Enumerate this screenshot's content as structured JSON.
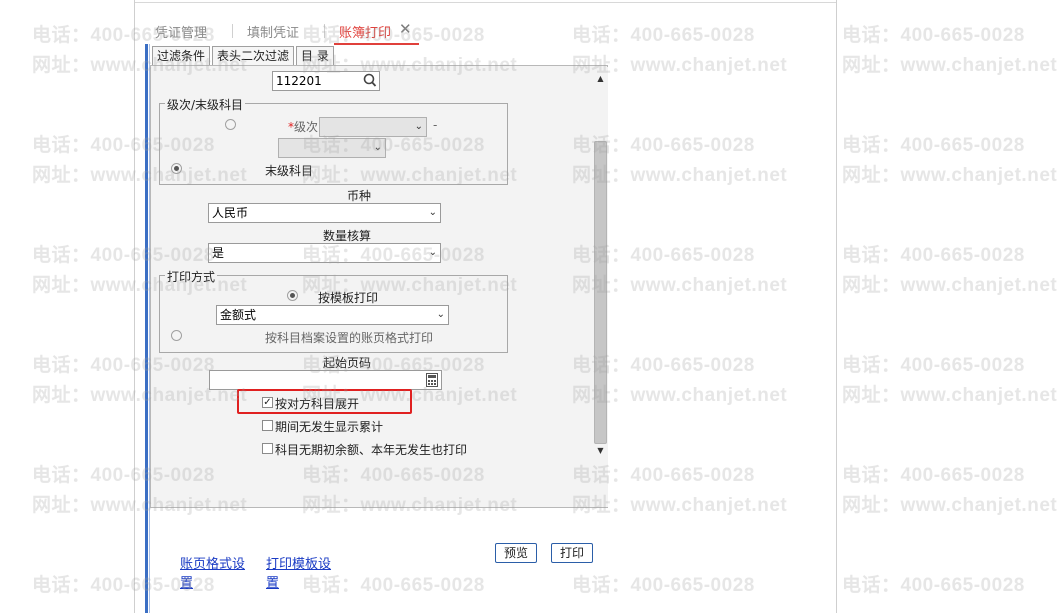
{
  "tabs": [
    {
      "label": "凭证管理",
      "active": false
    },
    {
      "label": "填制凭证",
      "active": false
    },
    {
      "label": "账簿打印",
      "active": true,
      "closable": true
    }
  ],
  "close_icon": "close-icon",
  "sub_tabs": [
    "过滤条件",
    "表头二次过滤",
    "目 录"
  ],
  "filter": {
    "subject_code_value": "112201",
    "search_icon": "search-icon",
    "level_group": {
      "legend": "级次/末级科目",
      "level_label": "级次",
      "level_required_mark": "*",
      "range_dash": "-",
      "level_selected": false,
      "last_level_label": "末级科目",
      "last_level_selected": true
    },
    "currency": {
      "label": "币种",
      "value": "人民币"
    },
    "quantity": {
      "label": "数量核算",
      "value": "是"
    },
    "print_mode": {
      "legend": "打印方式",
      "by_template_label": "按模板打印",
      "by_template_selected": true,
      "template_value": "金额式",
      "by_archive_label": "按科目档案设置的账页格式打印",
      "by_archive_selected": false
    },
    "start_page": {
      "label": "起始页码",
      "value": "",
      "icon": "calculator-icon"
    },
    "options": [
      {
        "label": "按对方科目展开",
        "checked": true
      },
      {
        "label": "期间无发生显示累计",
        "checked": false
      },
      {
        "label": "科目无期初余额、本年无发生也打印",
        "checked": false
      }
    ]
  },
  "links": {
    "page_format_line1": "账页格式设",
    "page_format_line2": "置",
    "print_template_line1": "打印模板设",
    "print_template_line2": "置"
  },
  "buttons": {
    "preview": "预览",
    "print": "打印"
  },
  "watermark": {
    "phone": "电话：400-665-0028",
    "site": "网址：www.chanjet.net"
  },
  "colors": {
    "active_tab": "#e0403b",
    "accent_bar": "#3b6fc4",
    "highlight": "#e02020",
    "link": "#1a3bc4"
  }
}
